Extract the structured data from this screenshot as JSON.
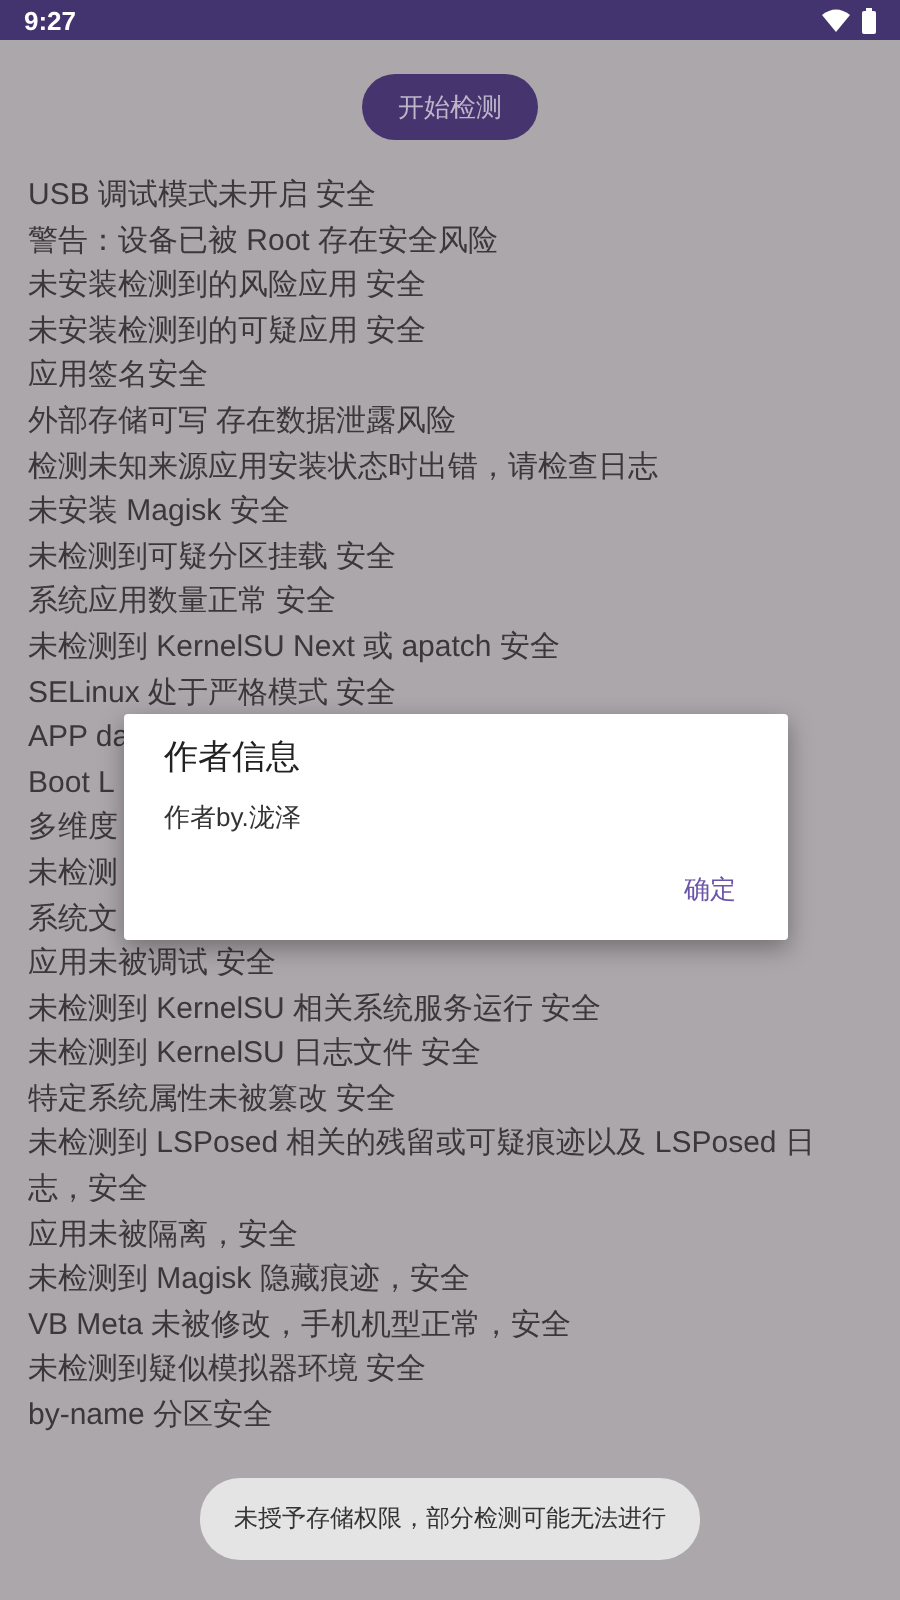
{
  "status_bar": {
    "time": "9:27"
  },
  "start_button": {
    "label": "开始检测"
  },
  "results": [
    "USB 调试模式未开启 安全",
    "警告：设备已被 Root 存在安全风险",
    "未安装检测到的风险应用 安全",
    "未安装检测到的可疑应用 安全",
    "应用签名安全",
    "外部存储可写 存在数据泄露风险",
    "检测未知来源应用安装状态时出错，请检查日志",
    "未安装 Magisk 安全",
    "未检测到可疑分区挂载 安全",
    "系统应用数量正常 安全",
    "未检测到 KernelSU Next 或 apatch 安全",
    "SELinux 处于严格模式 安全",
    "APP da",
    "Boot L",
    "多维度",
    "未检测",
    "系统文",
    "应用未被调试 安全",
    "未检测到 KernelSU 相关系统服务运行 安全",
    "未检测到 KernelSU 日志文件 安全",
    "特定系统属性未被篡改 安全",
    "未检测到 LSPosed 相关的残留或可疑痕迹以及 LSPosed 日志，安全",
    "应用未被隔离，安全",
    "未检测到 Magisk 隐藏痕迹，安全",
    "VB Meta 未被修改，手机机型正常，安全",
    "未检测到疑似模拟器环境 安全",
    "by-name 分区安全"
  ],
  "dialog": {
    "title": "作者信息",
    "message": "作者by.泷泽",
    "confirm": "确定"
  },
  "toast": "未授予存储权限，部分检测可能无法进行"
}
